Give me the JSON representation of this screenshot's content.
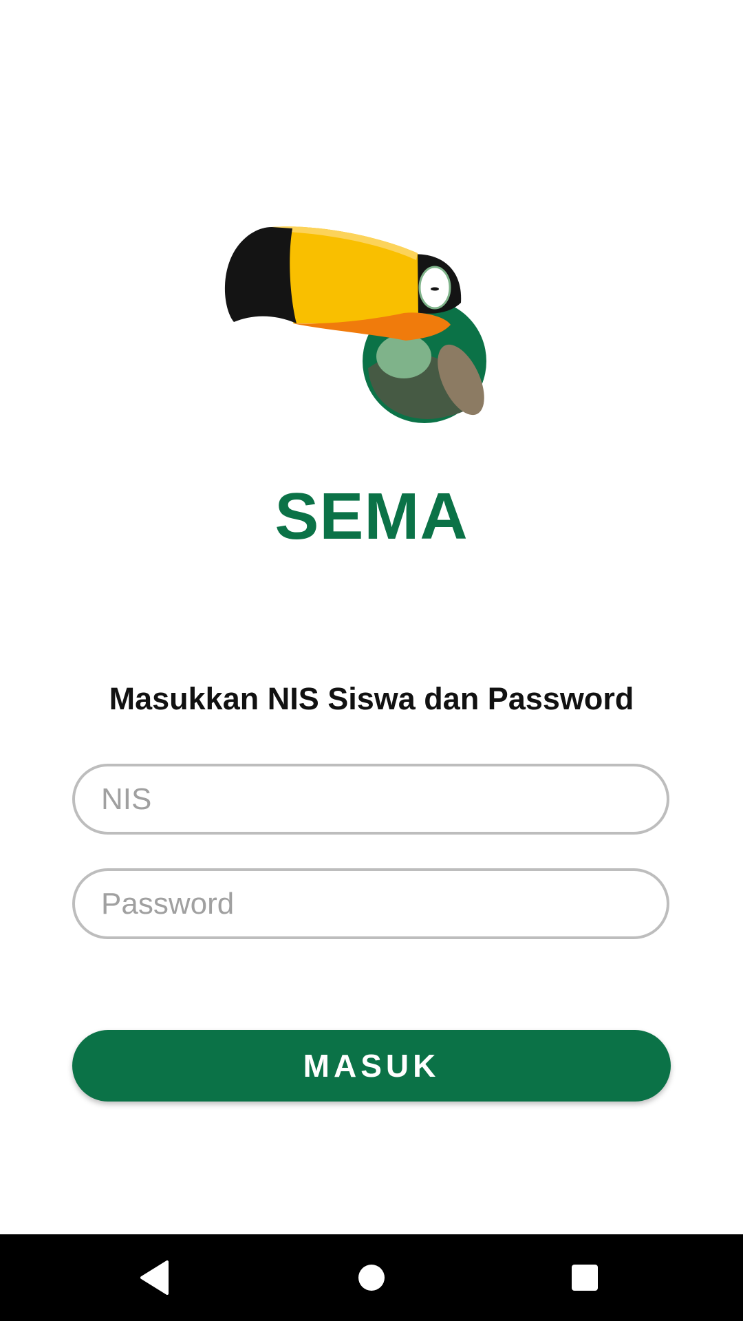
{
  "app": {
    "title": "SEMA",
    "brand_color": "#0b7247"
  },
  "login": {
    "instruction": "Masukkan NIS Siswa dan Password",
    "nis_placeholder": "NIS",
    "nis_value": "",
    "password_placeholder": "Password",
    "password_value": "",
    "submit_label": "MASUK"
  },
  "logo": {
    "icon": "toucan-logo",
    "colors": {
      "beak": "#f9bf00",
      "beak_tip": "#141414",
      "beak_underside": "#f07b0c",
      "body": "#0b7247",
      "belly": "#4a5c46",
      "wing": "#8c7b63",
      "chest": "#7fb38a"
    }
  },
  "navbar": {
    "icons": [
      "back-icon",
      "home-icon",
      "recents-icon"
    ]
  }
}
